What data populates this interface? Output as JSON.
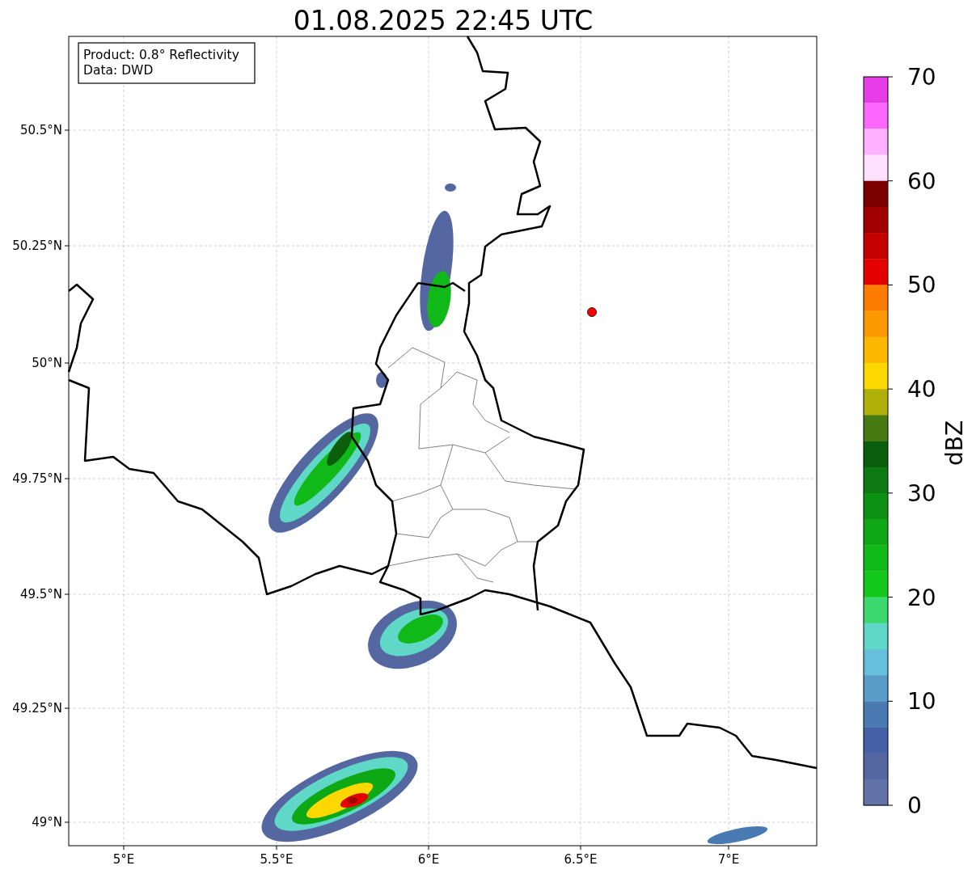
{
  "title": "01.08.2025 22:45 UTC",
  "info_box": {
    "lines": [
      "Product: 0.8° Reflectivity",
      "Data: DWD"
    ]
  },
  "x_axis": {
    "ticks": [
      "5°E",
      "5.5°E",
      "6°E",
      "6.5°E",
      "7°E"
    ]
  },
  "y_axis": {
    "ticks": [
      "50.5°N",
      "50.25°N",
      "50°N",
      "49.75°N",
      "49.5°N",
      "49.25°N",
      "49°N"
    ]
  },
  "colorbar": {
    "label": "dBZ",
    "ticks": [
      "70",
      "60",
      "50",
      "40",
      "30",
      "20",
      "10",
      "0"
    ],
    "segments": [
      {
        "color": "#e83ce8"
      },
      {
        "color": "#ff68ff"
      },
      {
        "color": "#ffb0ff"
      },
      {
        "color": "#ffe0ff"
      },
      {
        "color": "#7c0000"
      },
      {
        "color": "#a00000"
      },
      {
        "color": "#c40000"
      },
      {
        "color": "#e40000"
      },
      {
        "color": "#fc7c00"
      },
      {
        "color": "#fc9800"
      },
      {
        "color": "#fcb800"
      },
      {
        "color": "#fcd800"
      },
      {
        "color": "#b0b008"
      },
      {
        "color": "#467a10"
      },
      {
        "color": "#0a5e0c"
      },
      {
        "color": "#0c7a10"
      },
      {
        "color": "#0c9012"
      },
      {
        "color": "#0ea814"
      },
      {
        "color": "#10b818"
      },
      {
        "color": "#12c81a"
      },
      {
        "color": "#3cd870"
      },
      {
        "color": "#5fd8c8"
      },
      {
        "color": "#66c0dc"
      },
      {
        "color": "#5a9cc8"
      },
      {
        "color": "#4a7ab2"
      },
      {
        "color": "#4460a6"
      },
      {
        "color": "#5567a0"
      },
      {
        "color": "#6272a6"
      }
    ]
  }
}
